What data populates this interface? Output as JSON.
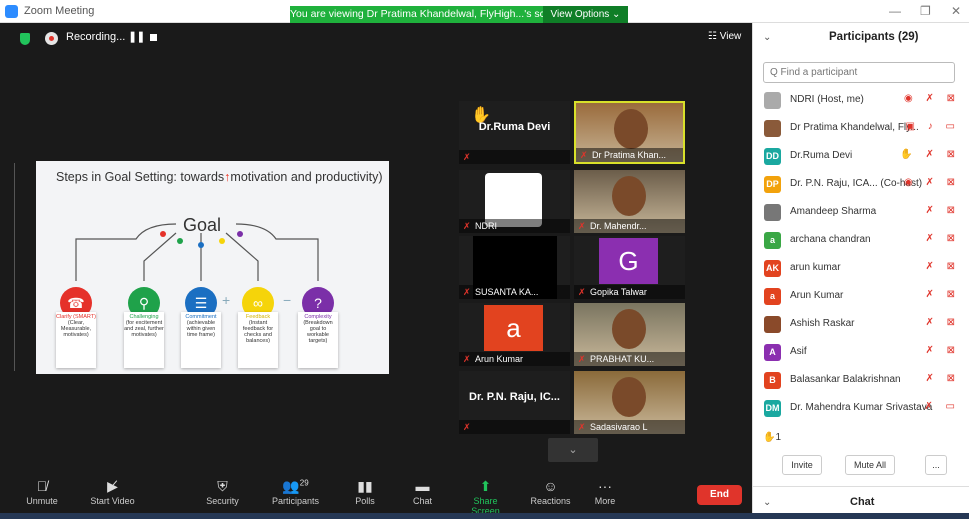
{
  "window": {
    "app_title": "Zoom Meeting"
  },
  "banner": {
    "viewing": "You are viewing Dr Pratima Khandelwal, FlyHigh...'s screen",
    "view_options": "View Options ⌄"
  },
  "window_controls": {
    "minimize": "—",
    "maximize": "❐",
    "close": "✕"
  },
  "meeting": {
    "recording_label": "Recording...",
    "pause_glyph": "❚❚",
    "view_label": "☷ View"
  },
  "slide": {
    "title_prefix": "Steps in Goal Setting: towards",
    "title_arrow": "↑",
    "title_suffix": "motivation and productivity)",
    "center": "Goal",
    "steps": [
      {
        "title": "Clarify (SMART)",
        "desc": "(Clear, Measurable, motivates)",
        "color": "#e5312a",
        "glyph": "☎",
        "title_color": "#e5312a"
      },
      {
        "title": "Challenging",
        "desc": "(for excitement and zeal, further motivates)",
        "color": "#1fa24a",
        "glyph": "⚲",
        "title_color": "#1fa24a"
      },
      {
        "title": "Commitment",
        "desc": "(achievable within given time frame)",
        "color": "#1b6fc2",
        "glyph": "☰",
        "title_color": "#1b6fc2"
      },
      {
        "title": "Feedback",
        "desc": "(Instant feedback for checks and balances)",
        "color": "#f5d40a",
        "glyph": "∞",
        "title_color": "#d4b400"
      },
      {
        "title": "Complexity",
        "desc": "(Breakdown goal to workable targets)",
        "color": "#7b2fa8",
        "glyph": "?",
        "title_color": "#7b2fa8"
      }
    ],
    "connectors": [
      "+",
      "−"
    ]
  },
  "tiles": [
    {
      "name": "",
      "center": "Dr.Ruma Devi",
      "icon": "✋",
      "type": "text"
    },
    {
      "name": "Dr Pratima Khan...",
      "type": "photo",
      "bg": "#9a6b3c"
    },
    {
      "name": "NDRI",
      "type": "logo"
    },
    {
      "name": "Dr. Mahendr...",
      "type": "photo",
      "bg": "#6b5d4a"
    },
    {
      "name": "SUSANTA KA...",
      "type": "black"
    },
    {
      "name": "Gopika Talwar",
      "type": "avatar",
      "letter": "G",
      "color": "#8b2fb0"
    },
    {
      "name": "Arun Kumar",
      "type": "avatar",
      "letter": "a",
      "color": "#e2431f"
    },
    {
      "name": "PRABHAT KU...",
      "type": "photo",
      "bg": "#7a7560"
    },
    {
      "name": "",
      "center": "Dr. P.N. Raju, IC...",
      "type": "text"
    },
    {
      "name": "Sadasivarao L",
      "type": "photo",
      "bg": "#8a6a3a"
    }
  ],
  "scroll_glyph": "⌄",
  "toolbar": {
    "unmute": "Unmute",
    "start_video": "Start Video",
    "security": "Security",
    "participants": "Participants",
    "participants_count": "29",
    "polls": "Polls",
    "chat": "Chat",
    "share_screen": "Share Screen",
    "reactions": "Reactions",
    "more": "More",
    "end": "End"
  },
  "panel": {
    "title": "Participants (29)",
    "search_placeholder": "Q Find a participant",
    "participants": [
      {
        "name": "NDRI (Host, me)",
        "avatar": "",
        "color": "#aaaaaa",
        "icons": "◉ ✗ ⊠"
      },
      {
        "name": "Dr Pratima Khandelwal, Fly...",
        "avatar": "",
        "color": "#8a5a3a",
        "icons": "▣ ♪ ▭"
      },
      {
        "name": "Dr.Ruma Devi",
        "avatar": "DD",
        "color": "#1aa8a0",
        "icons": "✋ ✗ ⊠"
      },
      {
        "name": "Dr. P.N. Raju, ICA...  (Co-host)",
        "avatar": "DP",
        "color": "#f2a20c",
        "icons": "◉ ✗ ⊠"
      },
      {
        "name": "Amandeep Sharma",
        "avatar": "",
        "color": "#777777",
        "icons": "✗ ⊠"
      },
      {
        "name": "archana chandran",
        "avatar": "a",
        "color": "#3aa745",
        "icons": "✗ ⊠"
      },
      {
        "name": "arun kumar",
        "avatar": "AK",
        "color": "#e2431f",
        "icons": "✗ ⊠"
      },
      {
        "name": "Arun Kumar",
        "avatar": "a",
        "color": "#e2431f",
        "icons": "✗ ⊠"
      },
      {
        "name": "Ashish Raskar",
        "avatar": "",
        "color": "#8a4a2a",
        "icons": "✗ ⊠"
      },
      {
        "name": "Asif",
        "avatar": "A",
        "color": "#8b2fb0",
        "icons": "✗ ⊠"
      },
      {
        "name": "Balasankar Balakrishnan",
        "avatar": "B",
        "color": "#e2431f",
        "icons": "✗ ⊠"
      },
      {
        "name": "Dr. Mahendra Kumar Srivastava",
        "avatar": "DM",
        "color": "#1aa8a0",
        "icons": "✗ ▭"
      }
    ],
    "raise_count": "✋1",
    "invite": "Invite",
    "mute_all": "Mute All",
    "more": "...",
    "chat": "Chat"
  }
}
